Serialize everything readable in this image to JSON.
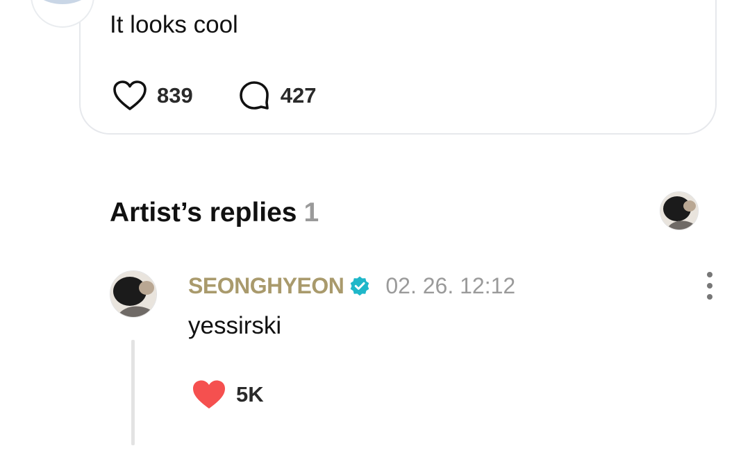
{
  "post": {
    "text": "It looks cool",
    "likes": "839",
    "comments": "427"
  },
  "replies_section": {
    "title": "Artist’s replies",
    "count": "1"
  },
  "reply": {
    "author": "SEONGHYEON",
    "verified": true,
    "timestamp": "02. 26. 12:12",
    "text": "yessirski",
    "likes": "5K"
  },
  "icons": {
    "like": "heart-outline-icon",
    "comment": "speech-bubble-icon",
    "verified": "verified-badge-icon",
    "liked": "heart-filled-icon",
    "more": "more-vertical-icon"
  },
  "colors": {
    "author_name": "#a99a6c",
    "verified_badge": "#1fb7c9",
    "liked_heart": "#f5504f",
    "muted_text": "#9a9a9a"
  }
}
